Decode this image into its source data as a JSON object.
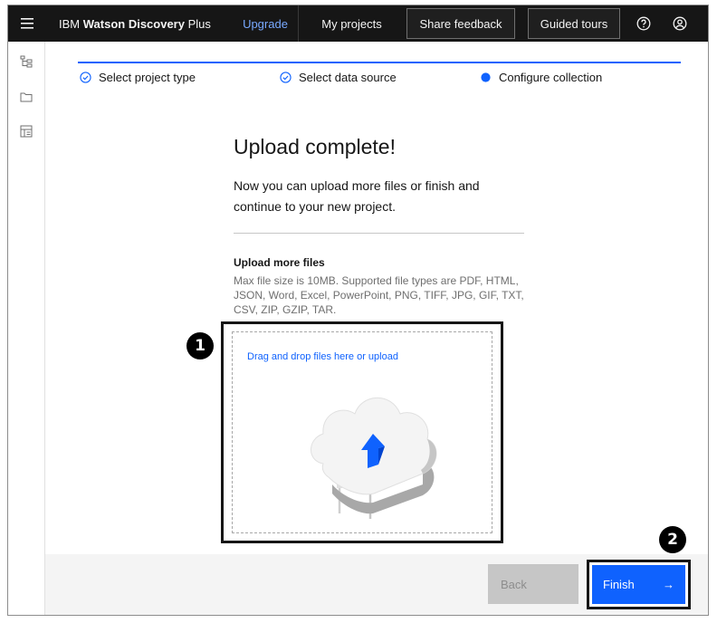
{
  "header": {
    "brand_prefix": "IBM",
    "brand_name": "Watson Discovery",
    "brand_suffix": "Plus",
    "upgrade": "Upgrade",
    "my_projects": "My projects",
    "share_feedback": "Share feedback",
    "guided_tours": "Guided tours",
    "help_icon": "help-icon",
    "user_icon": "user-avatar-icon"
  },
  "progress": {
    "steps": [
      {
        "label": "Select project type",
        "state": "complete"
      },
      {
        "label": "Select data source",
        "state": "complete"
      },
      {
        "label": "Configure collection",
        "state": "current"
      }
    ]
  },
  "main": {
    "title": "Upload complete!",
    "description": "Now you can upload more files or finish and continue to your new project.",
    "upload_heading": "Upload more files",
    "upload_info": "Max file size is 10MB. Supported file types are PDF, HTML, JSON, Word, Excel, PowerPoint, PNG, TIFF, JPG, GIF, TXT, CSV, ZIP, GZIP, TAR.",
    "drop_link": "Drag and drop files here or upload"
  },
  "callouts": {
    "one": "1",
    "two": "2"
  },
  "footer": {
    "back": "Back",
    "finish": "Finish",
    "finish_arrow": "→"
  },
  "colors": {
    "header_bg": "#161616",
    "accent": "#0f62fe",
    "link_upgrade": "#78a9ff",
    "disabled_btn": "#c6c6c6",
    "footer_bg": "#f4f4f4"
  }
}
